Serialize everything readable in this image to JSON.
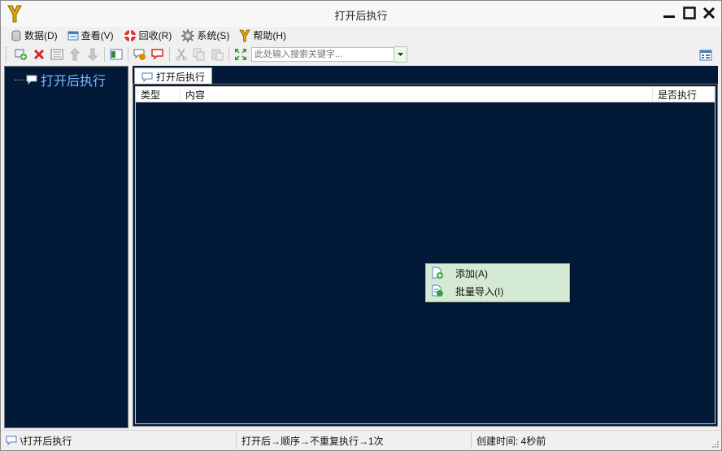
{
  "window": {
    "title": "打开后执行"
  },
  "menu": [
    {
      "label": "数据(D)",
      "icon": "database-icon"
    },
    {
      "label": "查看(V)",
      "icon": "view-icon"
    },
    {
      "label": "回收(R)",
      "icon": "lifebuoy-icon"
    },
    {
      "label": "系统(S)",
      "icon": "gear-icon"
    },
    {
      "label": "帮助(H)",
      "icon": "help-icon"
    }
  ],
  "toolbar": {
    "search_placeholder": "此处输入搜索关键字..."
  },
  "tree": {
    "root_label": "打开后执行"
  },
  "tab": {
    "label": "打开后执行"
  },
  "table": {
    "columns": [
      "类型",
      "内容",
      "是否执行"
    ],
    "rows": []
  },
  "context_menu": {
    "items": [
      {
        "label": "添加(A)"
      },
      {
        "label": "批量导入(I)"
      }
    ]
  },
  "status": {
    "path": "\\打开后执行",
    "mode": "打开后→顺序→不重复执行→1次",
    "created": "创建时间: 4秒前"
  },
  "colors": {
    "panel_bg": "#021a38",
    "tree_text": "#7fb6ff",
    "context_bg": "#d4ead4"
  }
}
